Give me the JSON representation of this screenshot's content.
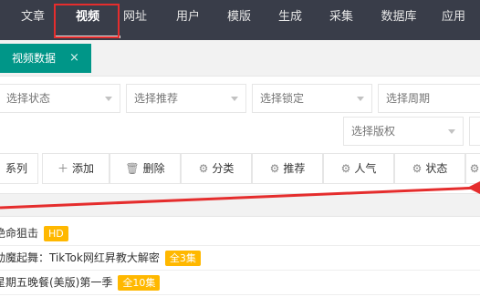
{
  "nav": {
    "items": [
      "文章",
      "视频",
      "网址",
      "用户",
      "模版",
      "生成",
      "采集",
      "数据库",
      "应用"
    ],
    "active": "视频"
  },
  "tabs": [
    {
      "label": "视频数据",
      "close": "×"
    }
  ],
  "filters": {
    "status": "选择状态",
    "recommend": "选择推荐",
    "lock": "选择锁定",
    "period": "选择周期",
    "copyright": "选择版权"
  },
  "toolbar": {
    "series": "系列",
    "add": "添加",
    "delete": "删除",
    "category": "分类",
    "recommend": "推荐",
    "popularity": "人气",
    "status": "状态"
  },
  "rows": [
    {
      "title": "绝命狙击",
      "badge": "HD"
    },
    {
      "title": "动魔起舞：TikTok网红昇教大解密",
      "badge": "全3集"
    },
    {
      "title": "星期五晚餐(美版)第一季",
      "badge": "全10集"
    }
  ],
  "colors": {
    "nav_bg": "#393d49",
    "tab_active": "#009688",
    "badge": "#ffb800",
    "annotation": "#e52d2d"
  }
}
